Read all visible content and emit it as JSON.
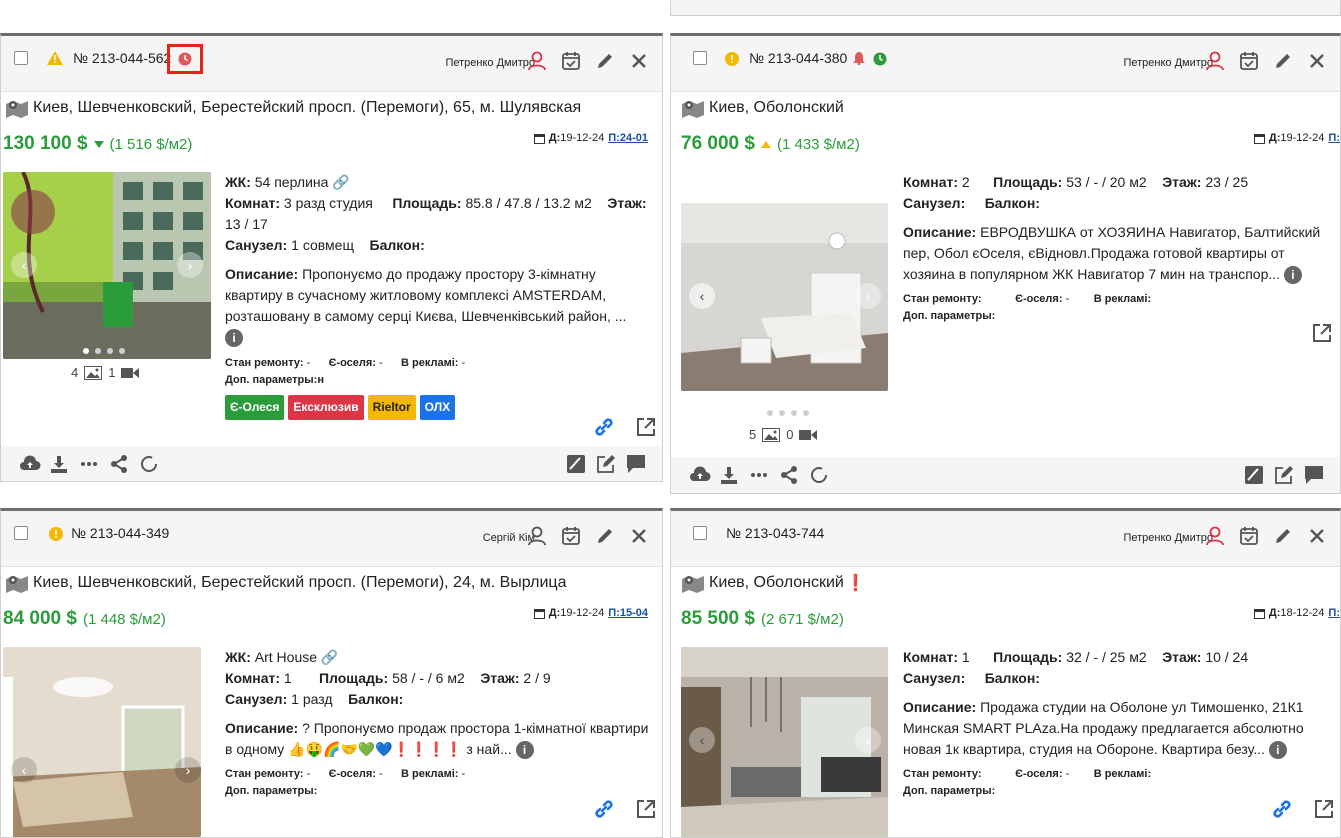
{
  "cards": [
    {
      "number": "№ 213-044-562",
      "agent": "Петренко Дмитро",
      "address": "Киев, Шевченковский, Берестейский просп. (Перемоги), 65, м. Шулявская",
      "price": "130 100 $",
      "price_per_m2": "(1 516 $/м2)",
      "date_label": "Д:",
      "date": "19-12-24",
      "p_label": "П:",
      "p_value": "24-01",
      "complex_label": "ЖК:",
      "complex": "54 перлина",
      "rooms_label": "Комнат:",
      "rooms": "3 разд студия",
      "area_label": "Площадь:",
      "area": "85.8 / 47.8 / 13.2 м2",
      "floor_label": "Этаж:",
      "floor": "13 / 17",
      "bath_label": "Санузел:",
      "bath": "1 совмещ",
      "balcony_label": "Балкон:",
      "desc_label": "Описание:",
      "desc": "Пропонуємо до продажу простору 3-кімнатну квартиру в сучасному житловому комплексі AMSTERDAM, розташовану в самому серці Києва, Шевченківський район, ...",
      "repair_label": "Стан ремонту:",
      "repair": "-",
      "eosel_label": "Є-оселя:",
      "eosel": "-",
      "ads_label": "В рекламі:",
      "ads": "-",
      "params_label": "Доп. параметры:",
      "params": "н",
      "photos": "4",
      "videos": "1",
      "tags": [
        {
          "label": "Є-Олеся",
          "color": "#2a9d3a"
        },
        {
          "label": "Ексклюзив",
          "color": "#dc3545"
        },
        {
          "label": "Rieltor",
          "color": "#f5b800",
          "text": "#222"
        },
        {
          "label": "ОЛХ",
          "color": "#1a73e8"
        }
      ]
    },
    {
      "number": "№ 213-044-380",
      "agent": "Петренко Дмитро",
      "address": "Киев, Оболонский",
      "price": "76 000 $",
      "price_per_m2": "(1 433 $/м2)",
      "date_label": "Д:",
      "date": "19-12-24",
      "p_label": "П:",
      "rooms_label": "Комнат:",
      "rooms": "2",
      "area_label": "Площадь:",
      "area": "53 / - / 20 м2",
      "floor_label": "Этаж:",
      "floor": "23 / 25",
      "bath_label": "Санузел:",
      "balcony_label": "Балкон:",
      "desc_label": "Описание:",
      "desc": "ЕВРОДВУШКА от ХОЗЯИНА Навигатор, Балтийский пер, Обол єОселя, єВідновл.Продажа готовой квартиры от хозяина в популярном ЖК Навигатор 7 мин на транспор...",
      "repair_label": "Стан ремонту:",
      "eosel_label": "Є-оселя:",
      "eosel": "-",
      "ads_label": "В рекламі:",
      "params_label": "Доп. параметры:",
      "photos": "5",
      "videos": "0"
    },
    {
      "number": "№ 213-044-349",
      "agent": "Сергій Кім",
      "address": "Киев, Шевченковский, Берестейский просп. (Перемоги), 24, м. Вырлица",
      "price": "84 000 $",
      "price_per_m2": "(1 448 $/м2)",
      "date_label": "Д:",
      "date": "19-12-24",
      "p_label": "П:",
      "p_value": "15-04",
      "complex_label": "ЖК:",
      "complex": "Art House",
      "rooms_label": "Комнат:",
      "rooms": "1",
      "area_label": "Площадь:",
      "area": "58 / - / 6 м2",
      "floor_label": "Этаж:",
      "floor": "2 / 9",
      "bath_label": "Санузел:",
      "bath": "1 разд",
      "balcony_label": "Балкон:",
      "desc_label": "Описание:",
      "desc": "? Пропонуємо продаж простора 1-кімнатної квартири в одному 👍🤑🌈🤝💚💙❗❗❗❗ з най...",
      "repair_label": "Стан ремонту:",
      "repair": "-",
      "eosel_label": "Є-оселя:",
      "eosel": "-",
      "ads_label": "В рекламі:",
      "ads": "-",
      "params_label": "Доп. параметры:"
    },
    {
      "number": "№ 213-043-744",
      "agent": "Петренко Дмитро",
      "address": "Киев, Оболонский",
      "address_mark": "❗",
      "price": "85 500 $",
      "price_per_m2": "(2 671 $/м2)",
      "date_label": "Д:",
      "date": "18-12-24",
      "p_label": "П:",
      "rooms_label": "Комнат:",
      "rooms": "1",
      "area_label": "Площадь:",
      "area": "32 / - / 25 м2",
      "floor_label": "Этаж:",
      "floor": "10 / 24",
      "bath_label": "Санузел:",
      "balcony_label": "Балкон:",
      "desc_label": "Описание:",
      "desc": "Продажа студии на Оболоне ул Тимошенко, 21К1 Минская SMART PLAza.На продажу предлагается абсолютно новая 1к квартира, студия на Обороне. Квартира безу...",
      "repair_label": "Стан ремонту:",
      "eosel_label": "Є-оселя:",
      "eosel": "-",
      "ads_label": "В рекламі:",
      "params_label": "Доп. параметры:"
    }
  ],
  "colors": {
    "green": "#2a9d3a",
    "red": "#dc3545",
    "highlight": "#e8241a",
    "icon": "#555555"
  }
}
